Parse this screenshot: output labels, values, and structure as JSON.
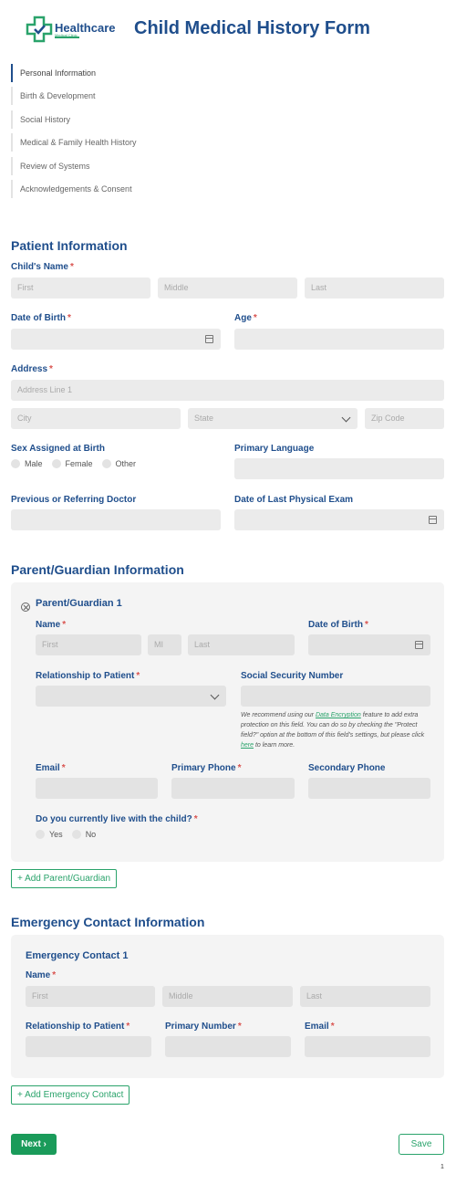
{
  "header": {
    "logo_name": "Healthcare",
    "logo_sub": "Medical Clinic",
    "title": "Child Medical History Form",
    "logo_icon": "medical-cross-check-icon",
    "brand_color": "#1f4e8c",
    "accent_color": "#2aa36b"
  },
  "nav": [
    {
      "label": "Personal Information"
    },
    {
      "label": "Birth & Development"
    },
    {
      "label": "Social History"
    },
    {
      "label": "Medical & Family Health History"
    },
    {
      "label": "Review of Systems"
    },
    {
      "label": "Acknowledgements & Consent"
    }
  ],
  "patient": {
    "title": "Patient Information",
    "child_name": "Child's Name",
    "first": "First",
    "middle": "Middle",
    "last": "Last",
    "dob": "Date of Birth",
    "age": "Age",
    "address": "Address",
    "address1": "Address Line 1",
    "city": "City",
    "state": "State",
    "zip": "Zip Code",
    "sex": "Sex Assigned at Birth",
    "male": "Male",
    "female": "Female",
    "other": "Other",
    "language": "Primary Language",
    "doctor": "Previous or Referring Doctor",
    "last_exam": "Date of Last Physical Exam"
  },
  "guardian": {
    "title": "Parent/Guardian Information",
    "block_title": "Parent/Guardian 1",
    "name": "Name",
    "first": "First",
    "mi": "MI",
    "last": "Last",
    "dob": "Date of Birth",
    "relationship": "Relationship to Patient",
    "ssn": "Social Security Number",
    "note_pre": "We recommend using our ",
    "note_link": "Data Encryption",
    "note_mid": " feature to add extra protection on this field. You can do so by checking the \"Protect field?\" option at the bottom of this field's settings, but please click ",
    "note_link2": "here",
    "note_post": " to learn more.",
    "email": "Email",
    "primary_phone": "Primary Phone",
    "secondary_phone": "Secondary Phone",
    "live_with": "Do you currently live with the child?",
    "yes": "Yes",
    "no": "No",
    "add": "+ Add Parent/Guardian"
  },
  "emergency": {
    "title": "Emergency Contact Information",
    "block_title": "Emergency Contact 1",
    "name": "Name",
    "first": "First",
    "middle": "Middle",
    "last": "Last",
    "relationship": "Relationship to Patient",
    "primary_number": "Primary Number",
    "email": "Email",
    "add": "+ Add Emergency Contact"
  },
  "footer": {
    "next": "Next",
    "save": "Save",
    "page": "1"
  }
}
